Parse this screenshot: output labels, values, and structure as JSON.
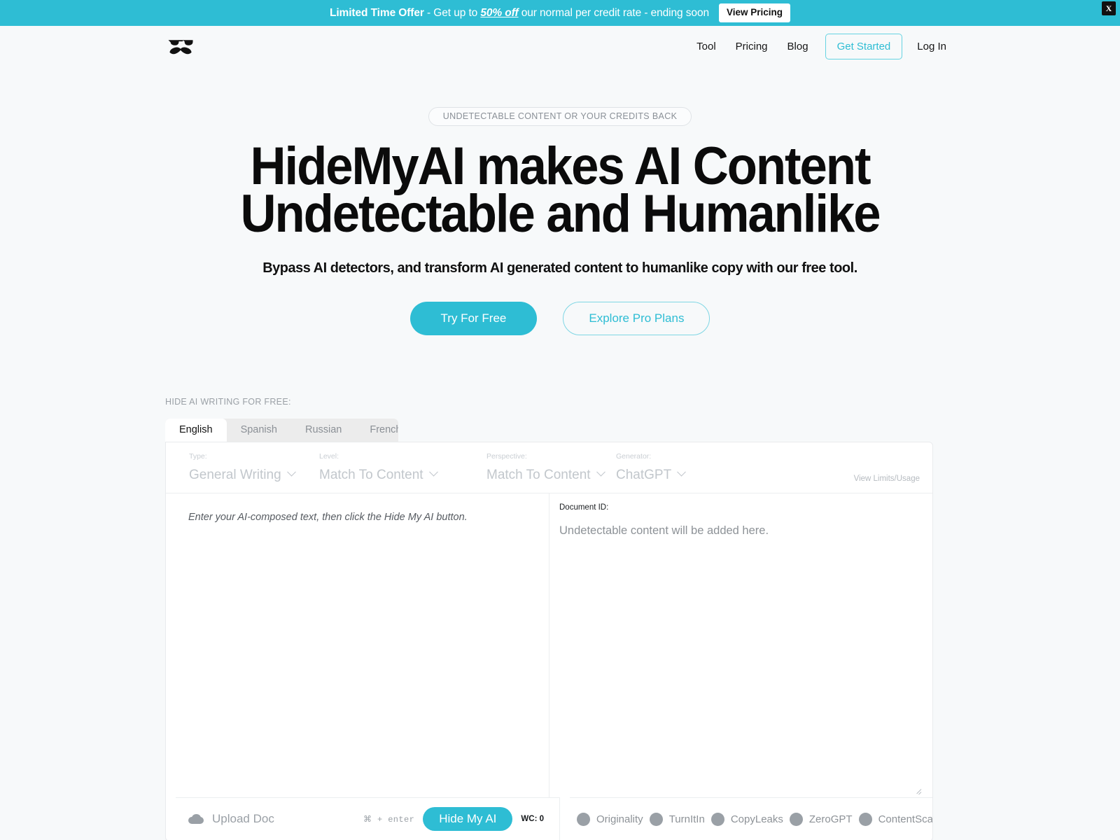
{
  "promo": {
    "strong": "Limited Time Offer",
    "mid_1": " - Get up to ",
    "underline": "50% off",
    "mid_2": " our normal per credit rate - ending soon",
    "button": "View Pricing",
    "close": "X",
    "bg_color": "#2ebdd4"
  },
  "header": {
    "logo_alt": "HideMyAI sunglasses and mustache logo",
    "nav": [
      {
        "label": "Tool"
      },
      {
        "label": "Pricing"
      },
      {
        "label": "Blog"
      }
    ],
    "cta": "Get Started",
    "login": "Log In",
    "accent_color": "#2ebdd4"
  },
  "hero": {
    "badge": "UNDETECTABLE CONTENT OR YOUR CREDITS BACK",
    "title_line_1": "HideMyAI makes AI Content",
    "title_line_2": "Undetectable and Humanlike",
    "subtitle": "Bypass AI detectors, and transform AI generated content to humanlike copy with our free tool.",
    "primary_cta": "Try For Free",
    "secondary_cta": "Explore Pro Plans"
  },
  "tool": {
    "eyebrow": "HIDE AI WRITING FOR FREE:",
    "tabs": [
      {
        "label": "English",
        "active": true
      },
      {
        "label": "Spanish",
        "active": false
      },
      {
        "label": "Russian",
        "active": false
      },
      {
        "label": "French",
        "active": false
      }
    ],
    "controls": [
      {
        "label": "Type:",
        "value": "General Writing"
      },
      {
        "label": "Level:",
        "value": "Match To Content"
      },
      {
        "label": "Perspective:",
        "value": "Match To Content"
      },
      {
        "label": "Generator:",
        "value": "ChatGPT"
      }
    ],
    "view_limits": "View Limits/Usage",
    "input_placeholder": "Enter your AI-composed text, then click the Hide My AI button.",
    "document_id_label": "Document ID:",
    "output_placeholder": "Undetectable content will be added here.",
    "upload_label": "Upload Doc",
    "shortcut_hint": "⌘ + enter",
    "submit_label": "Hide My AI",
    "word_count": "WC: 0",
    "detectors": [
      {
        "name": "Originality"
      },
      {
        "name": "TurnItIn"
      },
      {
        "name": "CopyLeaks"
      },
      {
        "name": "ZeroGPT"
      },
      {
        "name": "ContentScale"
      }
    ]
  }
}
